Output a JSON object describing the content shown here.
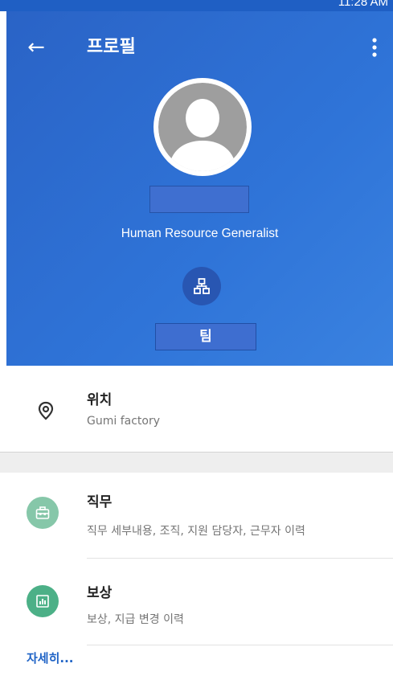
{
  "status_bar": {
    "clock": "11:28 AM"
  },
  "header": {
    "title": "프로필",
    "job_title": "Human Resource Generalist",
    "team_label": "팀"
  },
  "location": {
    "title": "위치",
    "value": "Gumi factory"
  },
  "list": [
    {
      "title": "직무",
      "subtitle": "직무 세부내용, 조직, 지원 담당자, 근무자 이력",
      "color": "#86c7a9"
    },
    {
      "title": "보상",
      "subtitle": "보상, 지급 변경 이력",
      "color": "#4cb087"
    }
  ],
  "details_link": "자세히...",
  "colors": {
    "header_blue": "#2f74d8",
    "link_blue": "#1f63c6"
  }
}
